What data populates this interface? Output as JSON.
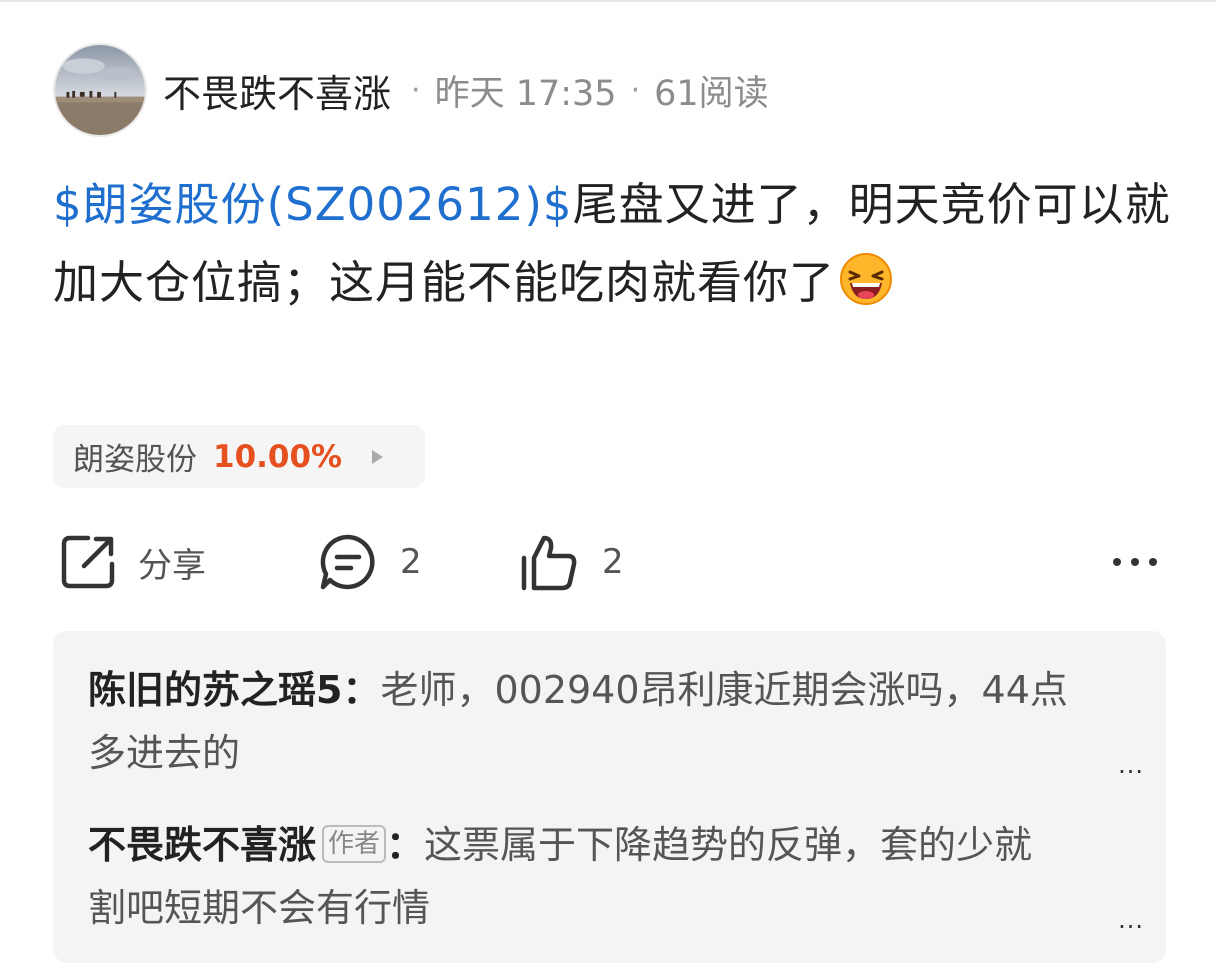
{
  "post": {
    "author": "不畏跌不喜涨",
    "separator": "·",
    "time": "昨天 17:35",
    "reads": "61阅读",
    "stock_link": "$朗姿股份(SZ002612)$",
    "text": "尾盘又进了，明天竞价可以就加大仓位搞；这月能不能吃肉就看你了",
    "emoji": "laughing-face-icon"
  },
  "stock_chip": {
    "name": "朗姿股份",
    "change": "10.00%",
    "change_color": "#e6501e"
  },
  "actions": {
    "share_label": "分享",
    "comment_count": "2",
    "like_count": "2"
  },
  "comments": [
    {
      "name": "陈旧的苏之瑶5",
      "colon": "：",
      "text": "老师，002940昂利康近期会涨吗，44点多进去的",
      "more": "..."
    },
    {
      "name": "不畏跌不喜涨",
      "badge": "作者",
      "colon": "：",
      "text": "这票属于下降趋势的反弹，套的少就割吧短期不会有行情",
      "more": "..."
    }
  ],
  "colors": {
    "link": "#1f6fcf",
    "accent_red": "#e6501e",
    "comment_bg": "#f4f4f6"
  }
}
